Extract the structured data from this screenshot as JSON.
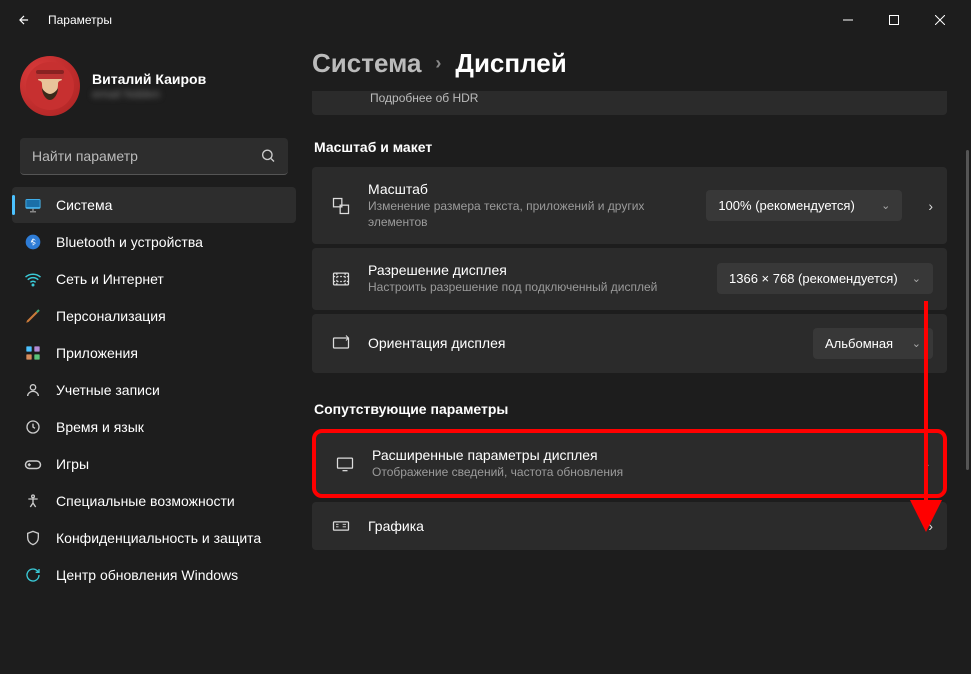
{
  "window": {
    "title": "Параметры"
  },
  "user": {
    "name": "Виталий Каиров",
    "email": "email hidden"
  },
  "search": {
    "placeholder": "Найти параметр"
  },
  "nav": [
    {
      "id": "system",
      "label": "Система",
      "active": true
    },
    {
      "id": "bluetooth",
      "label": "Bluetooth и устройства"
    },
    {
      "id": "network",
      "label": "Сеть и Интернет"
    },
    {
      "id": "personalization",
      "label": "Персонализация"
    },
    {
      "id": "apps",
      "label": "Приложения"
    },
    {
      "id": "accounts",
      "label": "Учетные записи"
    },
    {
      "id": "time",
      "label": "Время и язык"
    },
    {
      "id": "gaming",
      "label": "Игры"
    },
    {
      "id": "accessibility",
      "label": "Специальные возможности"
    },
    {
      "id": "privacy",
      "label": "Конфиденциальность и защита"
    },
    {
      "id": "update",
      "label": "Центр обновления Windows"
    }
  ],
  "breadcrumb": {
    "root": "Система",
    "current": "Дисплей"
  },
  "hdr_cut": "Подробнее об HDR",
  "sections": {
    "scale": {
      "title": "Масштаб и макет",
      "items": {
        "scale": {
          "head": "Масштаб",
          "sub": "Изменение размера текста, приложений и других элементов",
          "value": "100% (рекомендуется)"
        },
        "resolution": {
          "head": "Разрешение дисплея",
          "sub": "Настроить разрешение под подключенный дисплей",
          "value": "1366 × 768 (рекомендуется)"
        },
        "orientation": {
          "head": "Ориентация дисплея",
          "value": "Альбомная"
        }
      }
    },
    "related": {
      "title": "Сопутствующие параметры",
      "items": {
        "advanced": {
          "head": "Расширенные параметры дисплея",
          "sub": "Отображение сведений, частота обновления"
        },
        "graphics": {
          "head": "Графика"
        }
      }
    }
  }
}
